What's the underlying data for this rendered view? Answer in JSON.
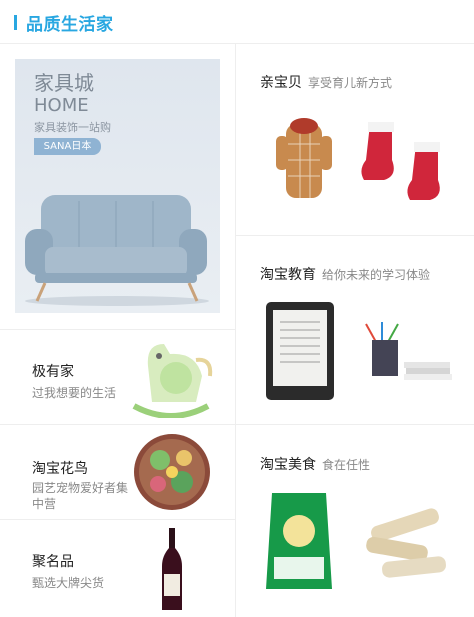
{
  "header": {
    "title": "品质生活家"
  },
  "banner": {
    "line1": "家具城",
    "line2": "HOME",
    "line3": "家具装饰一站购",
    "tag": "SANA日本"
  },
  "left": [
    {
      "name": "极有家",
      "sub": "过我想要的生活"
    },
    {
      "name": "淘宝花鸟",
      "sub": "园艺宠物爱好者集中营"
    },
    {
      "name": "聚名品",
      "sub": "甄选大牌尖货"
    }
  ],
  "right": [
    {
      "name": "亲宝贝",
      "sub": "享受育儿新方式"
    },
    {
      "name": "淘宝教育",
      "sub": "给你未来的学习体验"
    },
    {
      "name": "淘宝美食",
      "sub": "食在任性"
    }
  ],
  "colors": {
    "accent": "#29a7e1",
    "sofa": "#9fb6c9"
  }
}
